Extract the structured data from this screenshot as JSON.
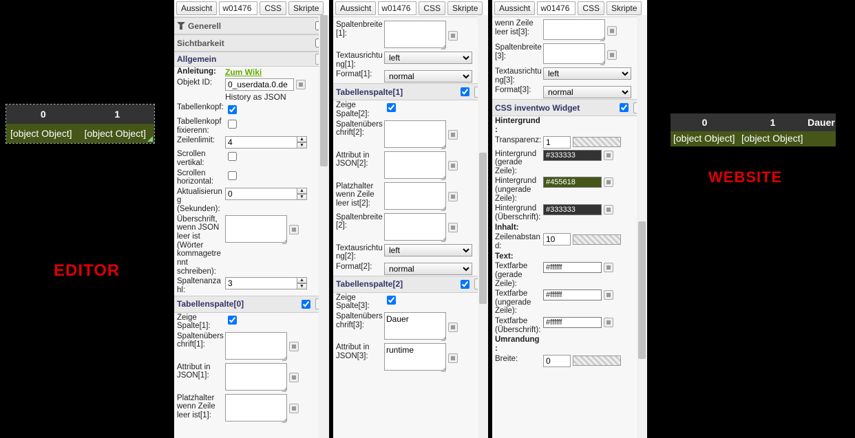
{
  "top": {
    "aussicht": "Aussicht",
    "id": "w01476",
    "css": "CSS",
    "skripte": "Skripte"
  },
  "editor": {
    "label": "EDITOR",
    "headers": [
      "0",
      "1"
    ],
    "cells": [
      "[object Object]",
      "[object Object]"
    ]
  },
  "website": {
    "label": "WEBSITE",
    "headers": [
      "0",
      "1",
      "Dauer"
    ],
    "cells": [
      "[object Object]",
      "[object Object]",
      ""
    ]
  },
  "col1": {
    "generell": "Generell",
    "sichtbarkeit": "Sichtbarkeit",
    "allgemein": "Allgemein",
    "anleitung_lbl": "Anleitung:",
    "anleitung_link": "Zum Wiki",
    "objektid_lbl": "Objekt ID:",
    "objektid_val": "0_userdata.0.de",
    "history": "History as JSON",
    "tabellenkopf_lbl": "Tabellenkopf:",
    "tabellenkopf_fix_lbl": "Tabellenkopf fixierenn:",
    "zeilenlimit_lbl": "Zeilenlimit:",
    "zeilenlimit_val": "4",
    "scroll_v_lbl": "Scrollen vertikal:",
    "scroll_h_lbl": "Scrollen horizontal:",
    "aktual_lbl": "Aktualisierung (Sekunden):",
    "aktual_val": "0",
    "ueberschrift_lbl": "Überschrift, wenn JSON leer ist (Wörter kommagetrennt schreiben):",
    "spaltenanzahl_lbl": "Spaltenanzahl:",
    "spaltenanzahl_val": "3",
    "tabellenspalte0": "Tabellenspalte[0]",
    "zeige1_lbl": "Zeige Spalte[1]:",
    "spaltenueb1_lbl": "Spaltenüberschrift[1]:",
    "attrjson1_lbl": "Attribut in JSON[1]:",
    "platz1_lbl": "Platzhalter wenn Zeile leer ist[1]:"
  },
  "col2": {
    "spaltenbreite1_lbl": "Spaltenbreite[1]:",
    "textaus1_lbl": "Textausrichtung[1]:",
    "textaus1_val": "left",
    "format1_lbl": "Format[1]:",
    "format1_val": "normal",
    "tabellenspalte1": "Tabellenspalte[1]",
    "zeige2_lbl": "Zeige Spalte[2]:",
    "spaltenueb2_lbl": "Spaltenüberschrift[2]:",
    "attrjson2_lbl": "Attribut in JSON[2]:",
    "platz2_lbl": "Platzhalter wenn Zeile leer ist[2]:",
    "spaltenbreite2_lbl": "Spaltenbreite[2]:",
    "textaus2_lbl": "Textausrichtung[2]:",
    "textaus2_val": "left",
    "format2_lbl": "Format[2]:",
    "format2_val": "normal",
    "tabellenspalte2": "Tabellenspalte[2]",
    "zeige3_lbl": "Zeige Spalte[3]:",
    "spaltenueb3_lbl": "Spaltenüberschrift[3]:",
    "spaltenueb3_val": "Dauer",
    "attrjson3_lbl": "Attribut in JSON[3]:",
    "attrjson3_val": "runtime"
  },
  "col3": {
    "platz3_lbl": "wenn Zeile leer ist[3]:",
    "spaltenbreite3_lbl": "Spaltenbreite[3]:",
    "textaus3_lbl": "Textausrichtung[3]:",
    "textaus3_val": "left",
    "format3_lbl": "Format[3]:",
    "format3_val": "normal",
    "css_section": "CSS inventwo Widget",
    "hintergrund": "Hintergrund:",
    "transparenz_lbl": "Transparenz:",
    "transparenz_val": "1",
    "bg_even_lbl": "Hintergrund (gerade Zeile):",
    "bg_even_val": "#333333",
    "bg_odd_lbl": "Hintergrund (ungerade Zeile):",
    "bg_odd_val": "#455618",
    "bg_head_lbl": "Hintergrund (Überschrift):",
    "bg_head_val": "#333333",
    "inhalt": "Inhalt:",
    "zeilenabstand_lbl": "Zeilenabstand:",
    "zeilenabstand_val": "10",
    "text": "Text:",
    "txt_even_lbl": "Textfarbe (gerade Zeile):",
    "txt_even_val": "#ffffff",
    "txt_odd_lbl": "Textfarbe (ungerade Zeile):",
    "txt_odd_val": "#ffffff",
    "txt_head_lbl": "Textfarbe (Überschrift):",
    "txt_head_val": "#ffffff",
    "umrandung": "Umrandung:",
    "breite_lbl": "Breite:",
    "breite_val": "0"
  }
}
